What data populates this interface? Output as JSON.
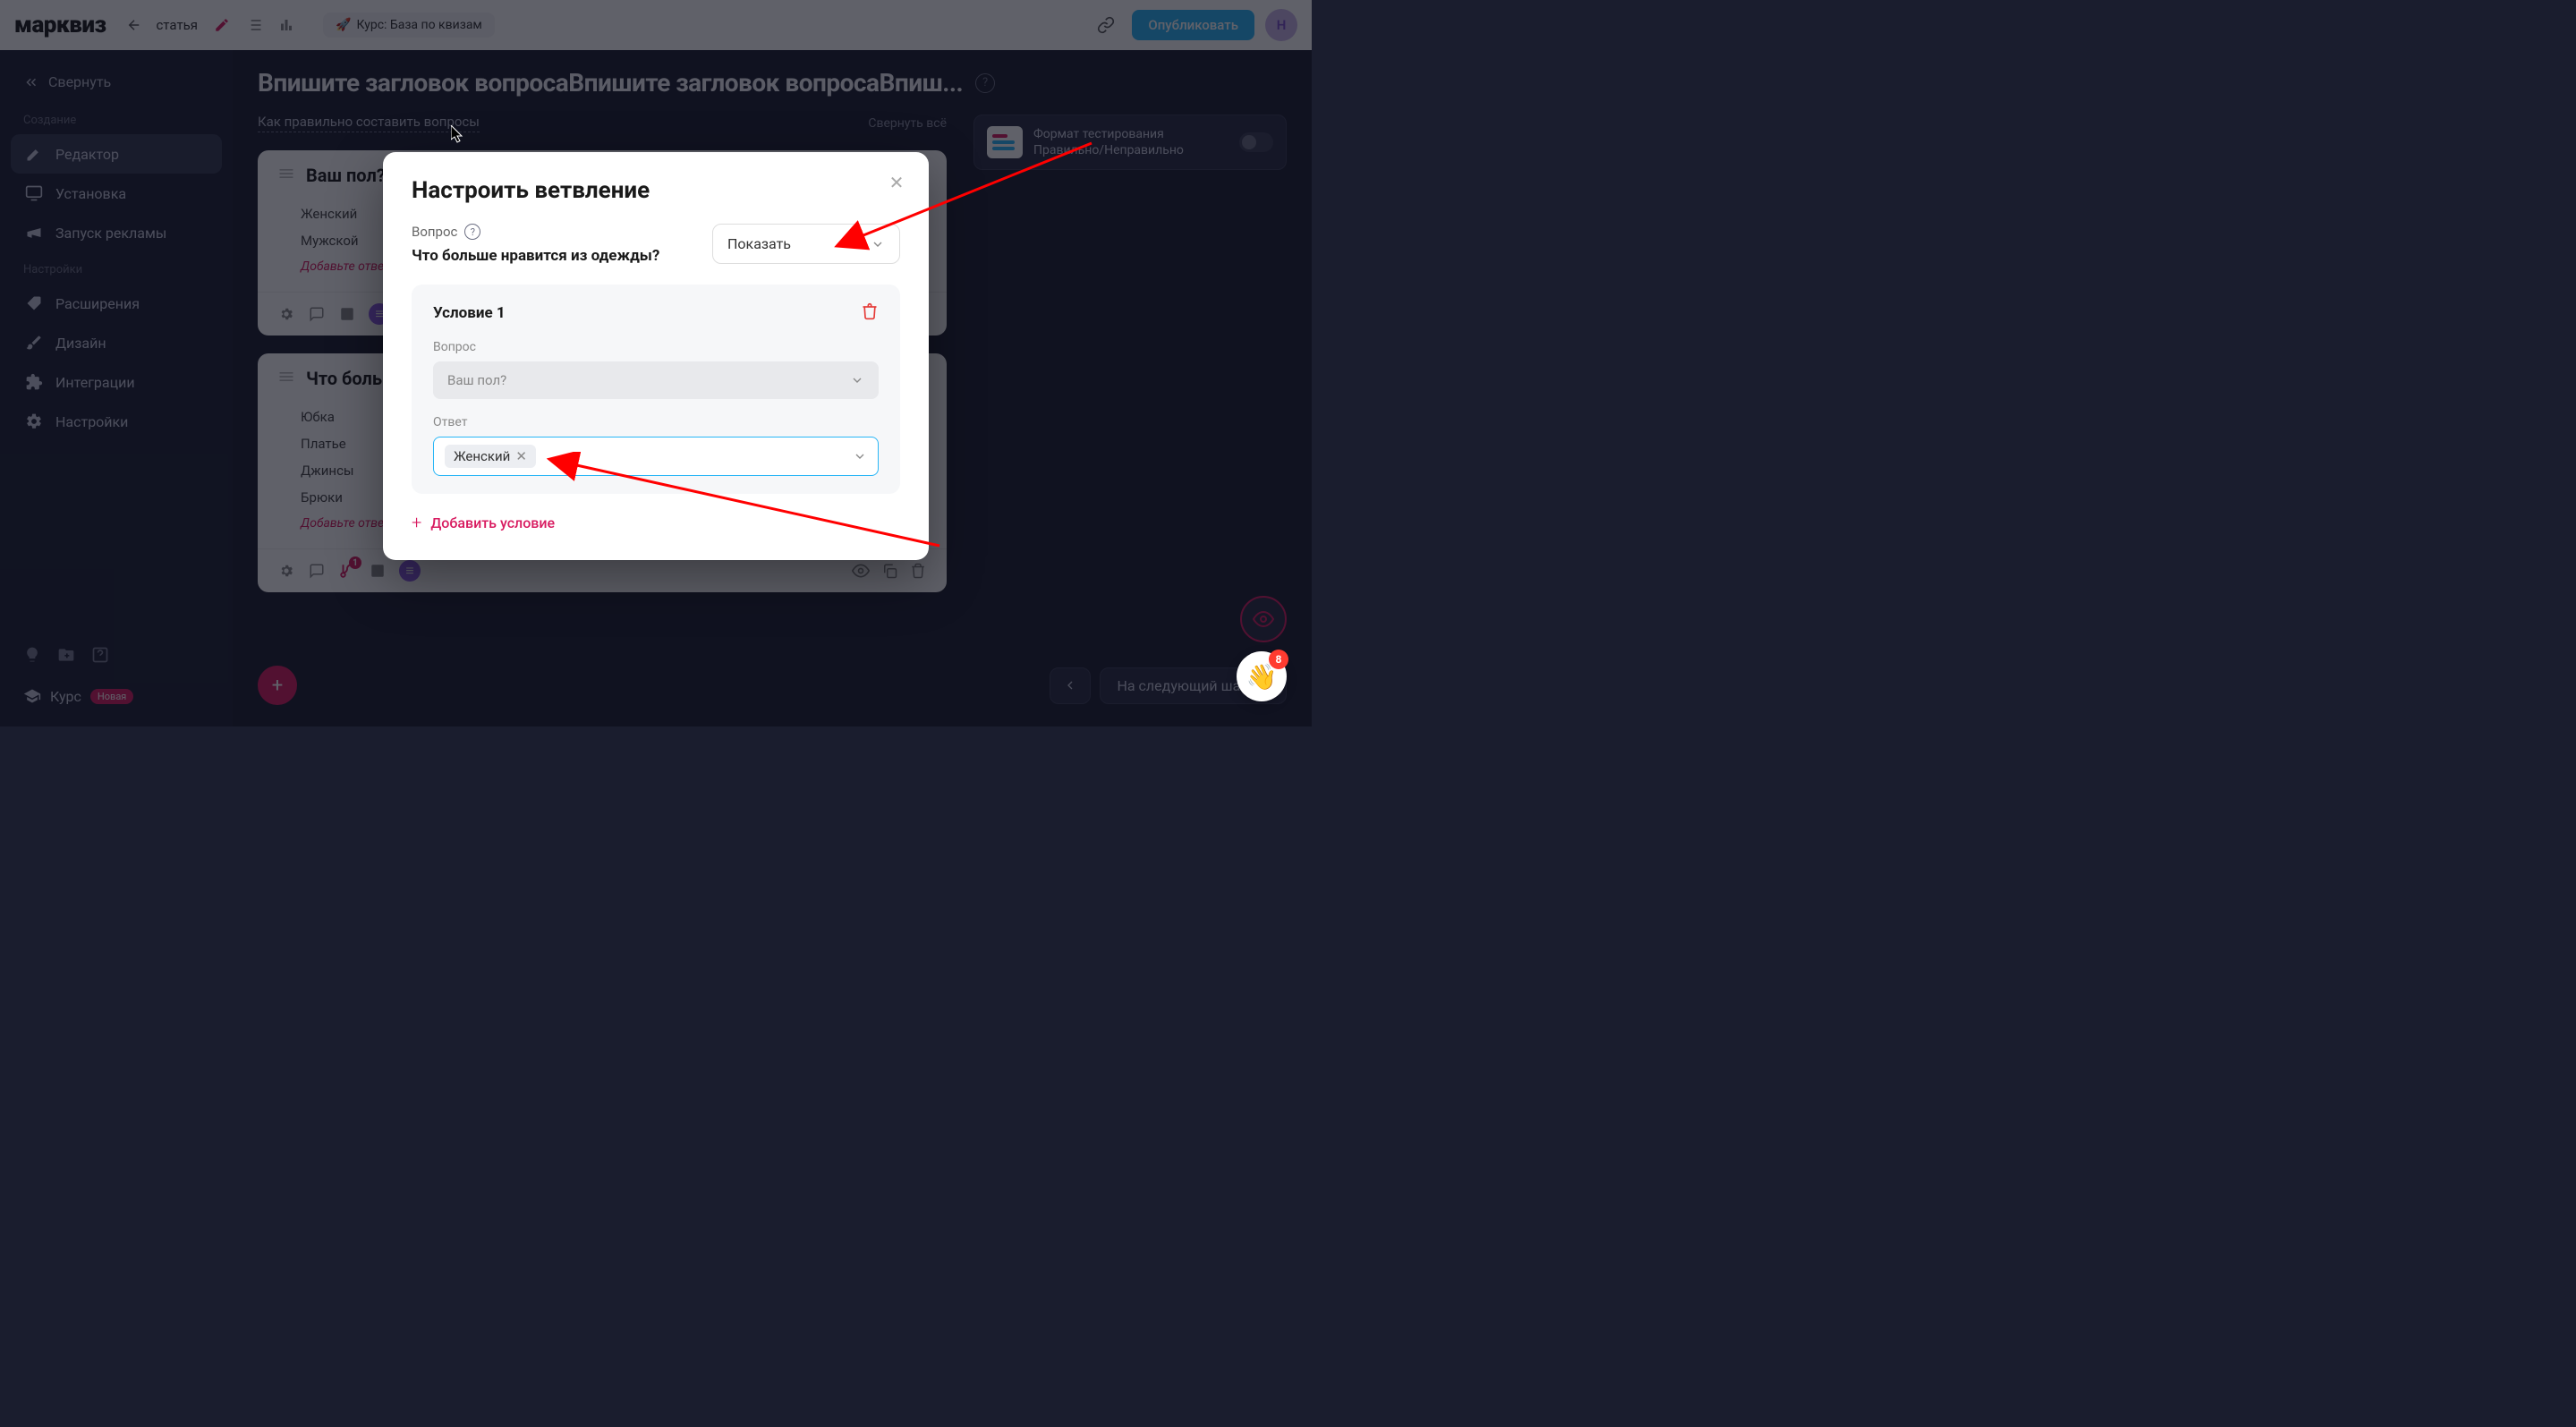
{
  "header": {
    "logo": "марквиз",
    "project_name": "статья",
    "course_btn": "Курс: База по квизам",
    "publish": "Опубликовать",
    "avatar_letter": "Н"
  },
  "sidebar": {
    "collapse": "Свернуть",
    "section_create": "Создание",
    "section_settings": "Настройки",
    "items": {
      "editor": "Редактор",
      "install": "Установка",
      "ads": "Запуск рекламы",
      "extensions": "Расширения",
      "design": "Дизайн",
      "integrations": "Интеграции",
      "settings": "Настройки"
    },
    "course": "Курс",
    "badge_new": "Новая"
  },
  "main": {
    "title": "Впишите загловок вопросаВпишите загловок вопросаВпиш...",
    "help_link": "Как правильно составить вопросы",
    "collapse_all": "Свернуть всё",
    "add_answer": "Добавьте ответ",
    "add_answer2": "Добавьте ответ или нажмите \"Enter\"",
    "next_step": "На следующий шаг"
  },
  "right_panel": {
    "format_line1": "Формат тестирования",
    "format_line2": "Правильно/Неправильно"
  },
  "q1": {
    "title": "Ваш пол?",
    "a1": "Женский",
    "a2": "Мужской"
  },
  "q2": {
    "title": "Что больш",
    "a1": "Юбка",
    "a2": "Платье",
    "a3": "Джинсы",
    "a4": "Брюки",
    "branch_count": "1"
  },
  "modal": {
    "title": "Настроить ветвление",
    "question_label": "Вопрос",
    "question_text": "Что больше нравится из одежды?",
    "show_value": "Показать",
    "cond_title": "Условие 1",
    "cond_q_label": "Вопрос",
    "cond_q_value": "Ваш пол?",
    "ans_label": "Ответ",
    "ans_chip": "Женский",
    "add_cond": "Добавить условие"
  },
  "chat": {
    "badge": "8"
  }
}
